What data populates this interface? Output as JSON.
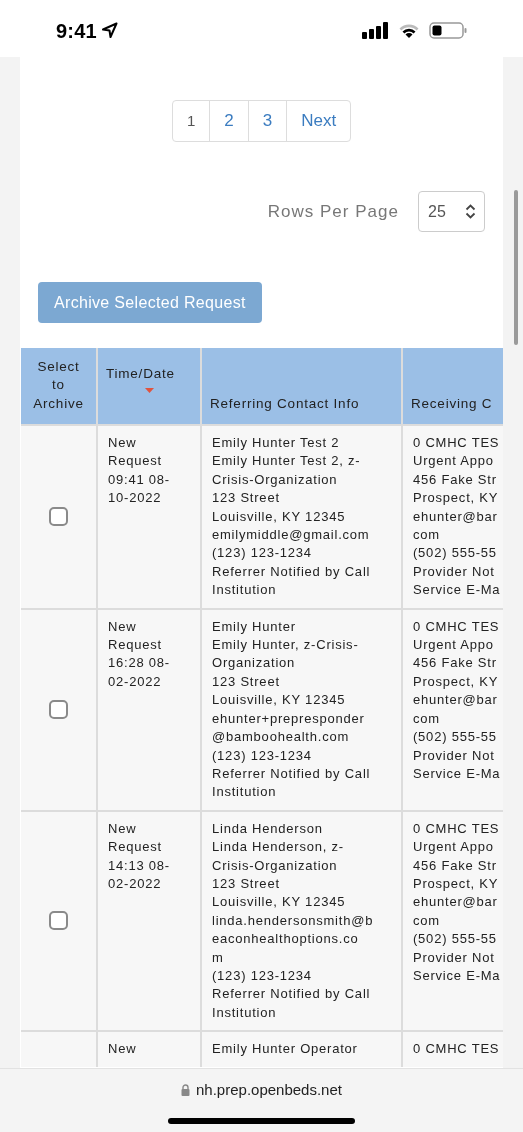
{
  "status_bar": {
    "time": "9:41"
  },
  "pagination": [
    {
      "label": "1",
      "selected": true
    },
    {
      "label": "2",
      "selected": false
    },
    {
      "label": "3",
      "selected": false
    },
    {
      "label": "Next",
      "selected": false
    }
  ],
  "rows_per_page": {
    "label": "Rows Per Page",
    "value": "25"
  },
  "archive_button": {
    "label": "Archive Selected Request",
    "disabled": true
  },
  "table": {
    "columns": [
      {
        "label": "Select to Archive",
        "sorted": false
      },
      {
        "label": "Time/Date",
        "sorted": true
      },
      {
        "label": "Referring Contact Info",
        "sorted": false
      },
      {
        "label": "Receiving C",
        "sorted": false
      }
    ],
    "rows": [
      {
        "checked": false,
        "time_date": [
          "New",
          "Request",
          "09:41 08-",
          "10-2022"
        ],
        "referring": [
          "Emily Hunter Test 2",
          "Emily Hunter Test 2, z-",
          "Crisis-Organization",
          "123 Street",
          "Louisville, KY 12345",
          "emilymiddle@gmail.com",
          "(123) 123-1234",
          "Referrer Notified by Call",
          "Institution"
        ],
        "receiving": [
          "0 CMHC TES",
          "Urgent Appo",
          "456 Fake Str",
          "Prospect, KY",
          "ehunter@bar",
          "com",
          "(502) 555-55",
          "Provider Not",
          "Service E-Ma"
        ]
      },
      {
        "checked": false,
        "time_date": [
          "New",
          "Request",
          "16:28 08-",
          "02-2022"
        ],
        "referring": [
          "Emily Hunter",
          "Emily Hunter, z-Crisis-",
          "Organization",
          "123 Street",
          "Louisville, KY 12345",
          "ehunter+prepresponder",
          "@bamboohealth.com",
          "(123) 123-1234",
          "Referrer Notified by Call",
          "Institution"
        ],
        "receiving": [
          "0 CMHC TES",
          "Urgent Appo",
          "456 Fake Str",
          "Prospect, KY",
          "ehunter@bar",
          "com",
          "(502) 555-55",
          "Provider Not",
          "Service E-Ma"
        ]
      },
      {
        "checked": false,
        "time_date": [
          "New",
          "Request",
          "14:13 08-",
          "02-2022"
        ],
        "referring": [
          "Linda Henderson",
          "Linda Henderson, z-",
          "Crisis-Organization",
          "123 Street",
          "Louisville, KY 12345",
          "linda.hendersonsmith@b",
          "eaconhealthoptions.co",
          "m",
          "(123) 123-1234",
          "Referrer Notified by Call",
          "Institution"
        ],
        "receiving": [
          "0 CMHC TES",
          "Urgent Appo",
          "456 Fake Str",
          "Prospect, KY",
          "ehunter@bar",
          "com",
          "(502) 555-55",
          "Provider Not",
          "Service E-Ma"
        ]
      },
      {
        "time_date": [
          "New"
        ],
        "referring": [
          "Emily Hunter Operator"
        ],
        "receiving": [
          "0 CMHC TES"
        ]
      }
    ]
  },
  "browser_bar": {
    "url": "nh.prep.openbeds.net"
  }
}
